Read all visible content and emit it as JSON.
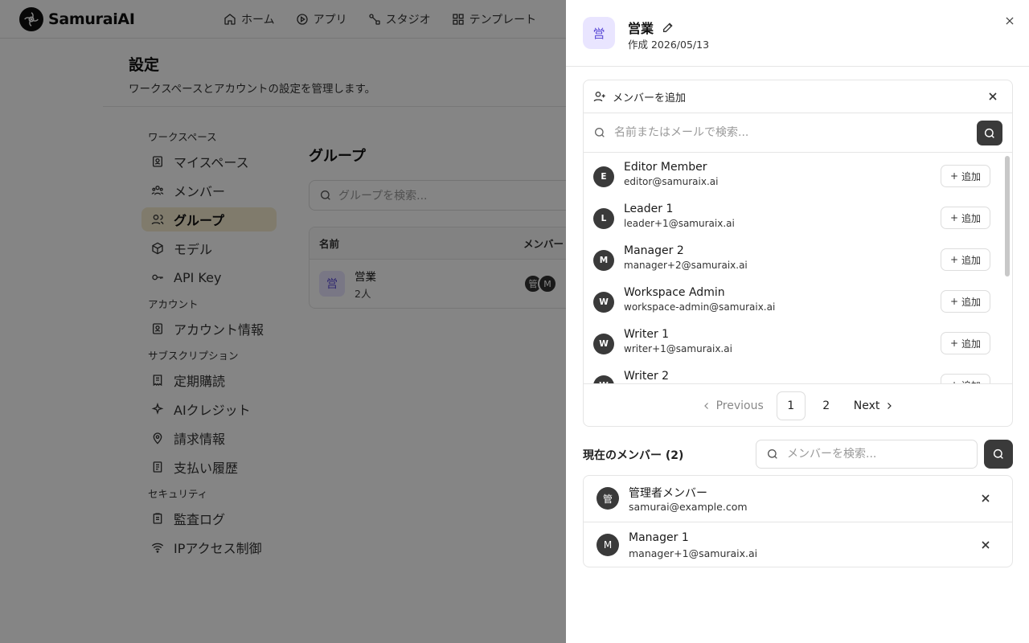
{
  "app": {
    "brand": "SamuraiAI",
    "topnav": [
      {
        "label": "ホーム",
        "icon": "home-icon"
      },
      {
        "label": "アプリ",
        "icon": "play-circle-icon"
      },
      {
        "label": "スタジオ",
        "icon": "workflow-icon"
      },
      {
        "label": "テンプレート",
        "icon": "grid-icon"
      }
    ],
    "settings_title": "設定",
    "settings_desc": "ワークスペースとアカウントの設定を管理します。",
    "sidenav": {
      "sections": [
        "ワークスペース",
        "アカウント",
        "サブスクリプション",
        "セキュリティ"
      ],
      "items": [
        {
          "label": "マイスペース",
          "icon": "id-card-icon"
        },
        {
          "label": "メンバー",
          "icon": "users-icon"
        },
        {
          "label": "グループ",
          "icon": "group-icon",
          "active": true
        },
        {
          "label": "モデル",
          "icon": "cube-icon"
        },
        {
          "label": "API Key",
          "icon": "key-icon"
        },
        {
          "label": "アカウント情報",
          "icon": "id-card-icon"
        },
        {
          "label": "定期購読",
          "icon": "receipt-icon"
        },
        {
          "label": "AIクレジット",
          "icon": "sparkle-icon"
        },
        {
          "label": "請求情報",
          "icon": "map-pin-icon"
        },
        {
          "label": "支払い履歴",
          "icon": "document-icon"
        },
        {
          "label": "監査ログ",
          "icon": "clipboard-icon"
        },
        {
          "label": "IPアクセス制御",
          "icon": "wifi-icon"
        }
      ]
    },
    "groups": {
      "title": "グループ",
      "search_placeholder": "グループを検索...",
      "col_name": "名前",
      "col_members": "メンバー",
      "rows": [
        {
          "avatar": "営",
          "name": "営業",
          "count": "2人",
          "member_avatars": [
            "管",
            "M"
          ]
        }
      ]
    }
  },
  "drawer": {
    "avatar": "営",
    "title": "営業",
    "created": "作成 2026/05/13",
    "add_members": {
      "header": "メンバーを追加",
      "search_placeholder": "名前またはメールで検索...",
      "add_label": "追加",
      "candidates": [
        {
          "initial": "E",
          "name": "Editor Member",
          "email": "editor@samuraix.ai"
        },
        {
          "initial": "L",
          "name": "Leader 1",
          "email": "leader+1@samuraix.ai"
        },
        {
          "initial": "M",
          "name": "Manager 2",
          "email": "manager+2@samuraix.ai"
        },
        {
          "initial": "W",
          "name": "Workspace Admin",
          "email": "workspace-admin@samuraix.ai"
        },
        {
          "initial": "W",
          "name": "Writer 1",
          "email": "writer+1@samuraix.ai"
        },
        {
          "initial": "W",
          "name": "Writer 2",
          "email": ""
        }
      ],
      "scroll_position": 0,
      "pagination": {
        "prev": "Previous",
        "pages": [
          "1",
          "2"
        ],
        "current": "1",
        "next": "Next"
      }
    },
    "current_members": {
      "title": "現在のメンバー (2)",
      "search_placeholder": "メンバーを検索...",
      "members": [
        {
          "initial": "管",
          "name": "管理者メンバー",
          "email": "samurai@example.com"
        },
        {
          "initial": "M",
          "name": "Manager 1",
          "email": "manager+1@samuraix.ai"
        }
      ]
    }
  },
  "colors": {
    "accent_avatar_bg": "#e9e5ff",
    "accent_avatar_fg": "#5b4bd6",
    "active_nav_bg": "#f5ecd0",
    "overlay": "rgba(0,0,0,0.48)"
  }
}
